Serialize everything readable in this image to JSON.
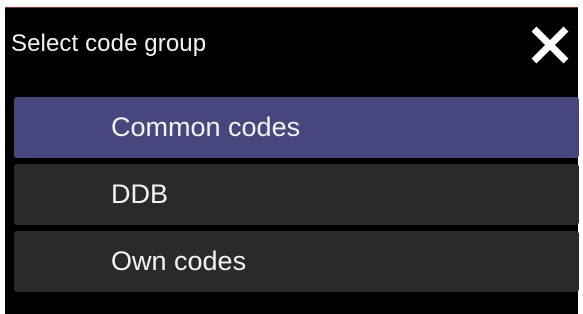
{
  "dialog": {
    "title": "Select code group",
    "close_icon": "close-icon"
  },
  "items": [
    {
      "label": "Common codes",
      "selected": true
    },
    {
      "label": "DDB",
      "selected": false
    },
    {
      "label": "Own codes",
      "selected": false
    }
  ],
  "colors": {
    "background": "#000000",
    "item_background": "#2a2a2a",
    "selected_background": "#48467e",
    "text": "#f2f2f2",
    "top_border": "#b22020"
  }
}
